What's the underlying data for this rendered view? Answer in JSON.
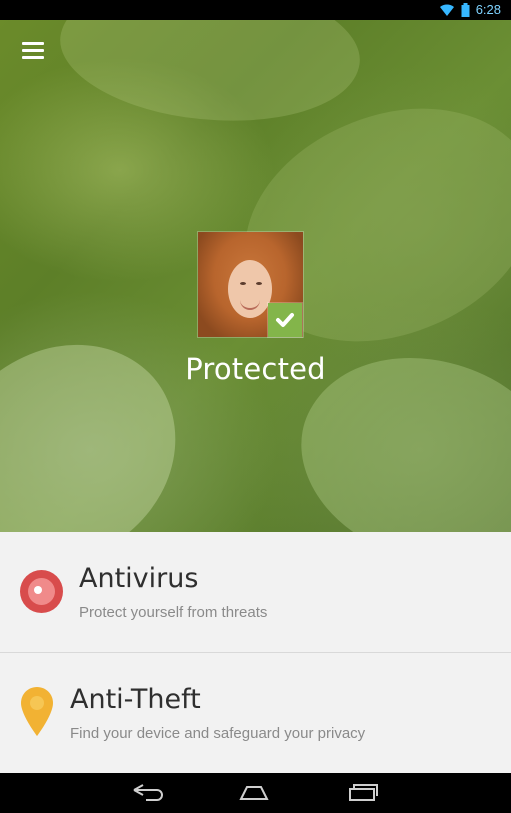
{
  "status_bar": {
    "time": "6:28",
    "icons": [
      "wifi-icon",
      "battery-icon"
    ]
  },
  "hero": {
    "menu_icon": "menu-icon",
    "status_text": "Protected",
    "status_icon": "checkmark-icon",
    "accent_color": "#83b54a"
  },
  "features": [
    {
      "title": "Antivirus",
      "subtitle": "Protect yourself from threats",
      "icon": "antivirus-icon",
      "color": "#d84c4c"
    },
    {
      "title": "Anti-Theft",
      "subtitle": "Find your device and safeguard your privacy",
      "icon": "location-pin-icon",
      "color": "#f2b233"
    }
  ],
  "nav_bar": {
    "buttons": [
      "back-icon",
      "home-icon",
      "recent-apps-icon"
    ]
  }
}
